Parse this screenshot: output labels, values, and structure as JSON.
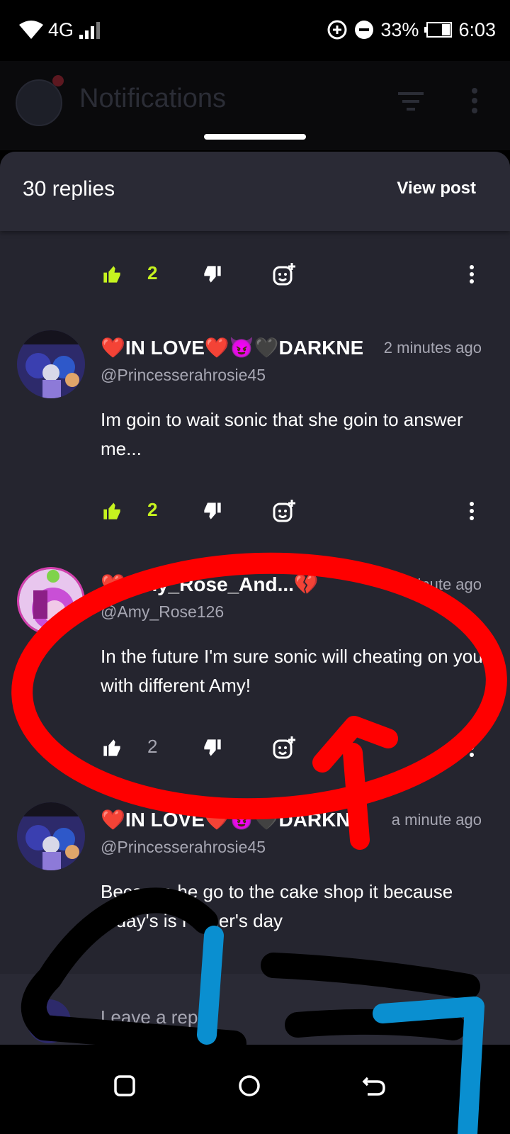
{
  "status_bar": {
    "network": "4G",
    "battery": "33%",
    "time": "6:03"
  },
  "background_screen": {
    "title": "Notifications"
  },
  "sheet": {
    "replies_count": "30 replies",
    "view_post_label": "View post"
  },
  "top_actions": {
    "like_count": "2",
    "liked": true
  },
  "comments": [
    {
      "author": "❤️IN LOVE❤️😈🖤DARKNESS",
      "time": "2 minutes ago",
      "handle": "@Princesserahrosie45",
      "text": "Im goin to wait sonic that she goin to answer me...",
      "like_count": "2",
      "liked": true
    },
    {
      "author": "❤️Amy_Rose_And...💔",
      "time": "a minute ago",
      "handle": "@Amy_Rose126",
      "text": "In the future I'm sure sonic will cheating on you with different Amy!",
      "like_count": "2",
      "liked": false
    },
    {
      "author": "❤️IN LOVE❤️😈🖤DARKNESS",
      "time": "a minute ago",
      "handle": "@Princesserahrosie45",
      "text": "Because he go to the cake shop it because today's is Father's day"
    }
  ],
  "composer": {
    "placeholder": "Leave a reply"
  },
  "colors": {
    "sheet_bg": "#25252f",
    "header_bg": "#2a2a35",
    "accent_like": "#c6f31f",
    "muted_text": "#a6a6b2",
    "annotation_red": "#ff0000",
    "annotation_blue": "#0a8fd0",
    "annotation_black": "#000000"
  },
  "icons": {
    "like": "thumbs-up-icon",
    "dislike": "thumbs-down-icon",
    "react": "add-emoji-icon",
    "more": "more-vertical-icon",
    "filter": "filter-icon"
  }
}
